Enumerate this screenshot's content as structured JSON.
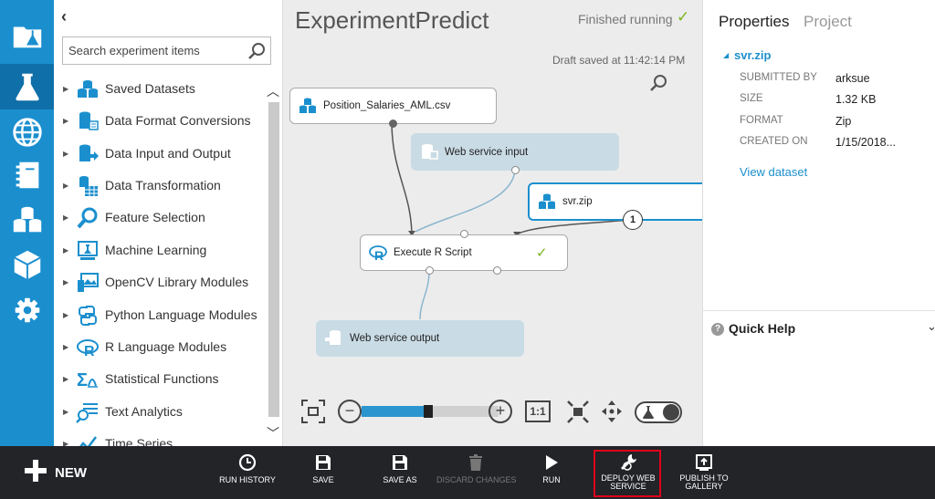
{
  "rail": {
    "items": [
      {
        "name": "projects",
        "icon": "folder-flask-icon"
      },
      {
        "name": "experiments",
        "icon": "flask-icon",
        "active": true
      },
      {
        "name": "web-services",
        "icon": "globe-icon"
      },
      {
        "name": "notebooks",
        "icon": "notebook-icon"
      },
      {
        "name": "datasets",
        "icon": "datasets-icon"
      },
      {
        "name": "trained-models",
        "icon": "cube-icon"
      },
      {
        "name": "settings",
        "icon": "gear-icon"
      }
    ]
  },
  "palette": {
    "search_placeholder": "Search experiment items",
    "items": [
      {
        "label": "Saved Datasets",
        "icon": "datasets-icon"
      },
      {
        "label": "Data Format Conversions",
        "icon": "data-convert-icon"
      },
      {
        "label": "Data Input and Output",
        "icon": "data-io-icon"
      },
      {
        "label": "Data Transformation",
        "icon": "data-transform-icon"
      },
      {
        "label": "Feature Selection",
        "icon": "feature-selection-icon"
      },
      {
        "label": "Machine Learning",
        "icon": "machine-learning-icon"
      },
      {
        "label": "OpenCV Library Modules",
        "icon": "opencv-icon"
      },
      {
        "label": "Python Language Modules",
        "icon": "python-icon"
      },
      {
        "label": "R Language Modules",
        "icon": "r-language-icon"
      },
      {
        "label": "Statistical Functions",
        "icon": "statistics-icon"
      },
      {
        "label": "Text Analytics",
        "icon": "text-analytics-icon"
      },
      {
        "label": "Time Series",
        "icon": "time-series-icon"
      }
    ]
  },
  "canvas": {
    "title": "ExperimentPredict",
    "status": "Finished running",
    "draft_saved": "Draft saved at 11:42:14 PM",
    "nodes": {
      "csv": "Position_Salaries_AML.csv",
      "ws_input": "Web service input",
      "svr": "svr.zip",
      "rscript": "Execute R Script",
      "ws_output": "Web service output"
    },
    "connection_badge": "1",
    "zoom_level": 0.45,
    "zoom_11_label": "1:1",
    "zoom_minus": "−",
    "zoom_plus": "+"
  },
  "properties": {
    "tabs": [
      "Properties",
      "Project"
    ],
    "dataset_name": "svr.zip",
    "fields": [
      {
        "key": "SUBMITTED BY",
        "value": "arksue"
      },
      {
        "key": "SIZE",
        "value": "1.32 KB"
      },
      {
        "key": "FORMAT",
        "value": "Zip"
      },
      {
        "key": "CREATED ON",
        "value": "1/15/2018..."
      }
    ],
    "view_dataset": "View dataset",
    "quick_help": "Quick Help"
  },
  "toolbar": {
    "new_label": "NEW",
    "buttons": [
      {
        "label": "RUN HISTORY",
        "icon": "clock-icon",
        "disabled": false
      },
      {
        "label": "SAVE",
        "icon": "save-icon",
        "disabled": false
      },
      {
        "label": "SAVE AS",
        "icon": "save-as-icon",
        "disabled": false
      },
      {
        "label": "DISCARD CHANGES",
        "icon": "trash-icon",
        "disabled": true
      },
      {
        "label": "RUN",
        "icon": "play-icon",
        "disabled": false
      },
      {
        "label": "DEPLOY WEB SERVICE",
        "line1": "DEPLOY WEB",
        "line2": "SERVICE",
        "icon": "deploy-icon",
        "disabled": false
      },
      {
        "label": "PUBLISH TO GALLERY",
        "line1": "PUBLISH TO",
        "line2": "GALLERY",
        "icon": "publish-icon",
        "disabled": false
      }
    ]
  },
  "colors": {
    "rail": "#1b8fce",
    "rail_active": "#0f6fa8",
    "canvas": "#ececec",
    "toolbar": "#222428",
    "success": "#7ab51d",
    "highlight": "#e0001a"
  }
}
